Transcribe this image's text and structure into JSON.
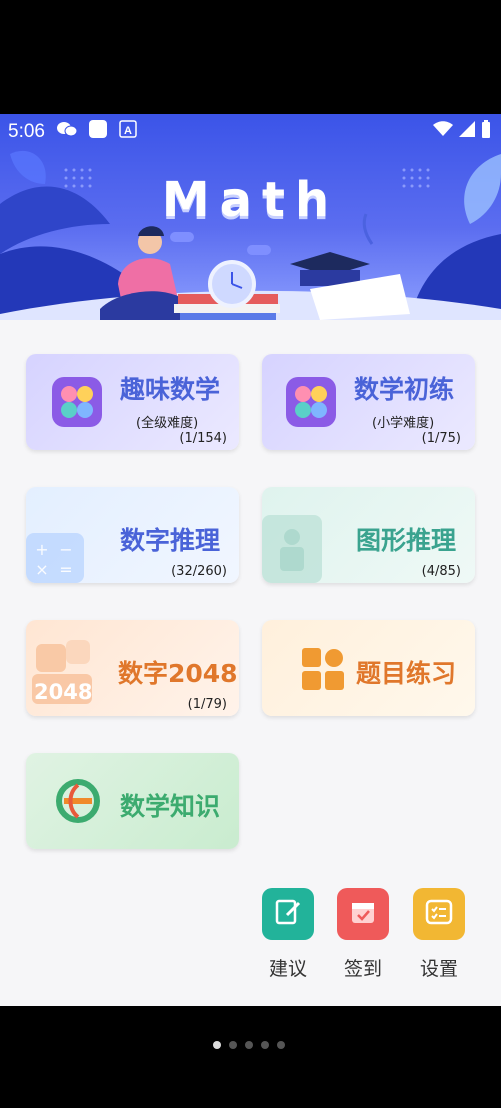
{
  "status_bar": {
    "time": "5:06"
  },
  "banner": {
    "title": "Math"
  },
  "cards": [
    {
      "title": "趣味数学",
      "subtitle": "(全级难度)",
      "count": "(1/154)"
    },
    {
      "title": "数学初练",
      "subtitle": "(小学难度)",
      "count": "(1/75)"
    },
    {
      "title": "数字推理",
      "count": "(32/260)"
    },
    {
      "title": "图形推理",
      "count": "(4/85)"
    },
    {
      "title": "数字2048",
      "count": "(1/79)",
      "badge": "2048"
    },
    {
      "title": "题目练习"
    },
    {
      "title": "数学知识"
    }
  ],
  "bottom": [
    {
      "label": "建议",
      "icon": "edit-icon",
      "color": "#22b39a"
    },
    {
      "label": "签到",
      "icon": "calendar-icon",
      "color": "#ef5a5a"
    },
    {
      "label": "设置",
      "icon": "checklist-icon",
      "color": "#f2b733"
    }
  ],
  "colors": {
    "banner": "#3b54e8",
    "purple": "#8b5be6",
    "blue_text": "#4a63d8",
    "teal_text": "#3aa38f",
    "orange_text": "#e0772b",
    "green_text": "#3cab6f"
  }
}
